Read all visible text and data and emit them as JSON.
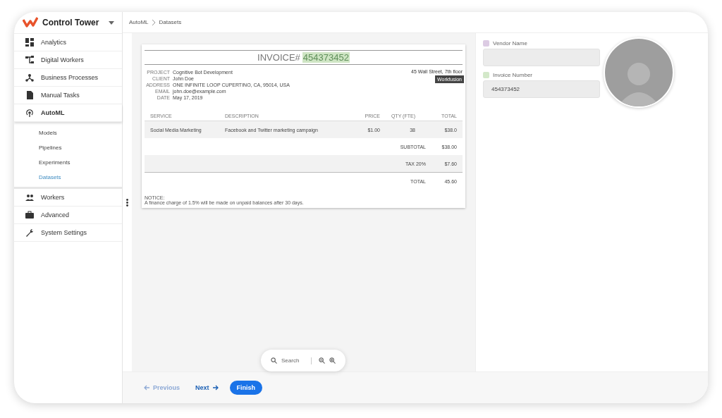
{
  "app": {
    "title": "Control Tower"
  },
  "sidebar": {
    "items": [
      {
        "label": "Analytics"
      },
      {
        "label": "Digital Workers"
      },
      {
        "label": "Business Processes"
      },
      {
        "label": "Manual Tasks"
      },
      {
        "label": "AutoML",
        "expanded": true,
        "children": [
          {
            "label": "Models",
            "selected": false
          },
          {
            "label": "Pipelines",
            "selected": false
          },
          {
            "label": "Experiments",
            "selected": false
          },
          {
            "label": "Datasets",
            "selected": true
          }
        ]
      },
      {
        "label": "Workers"
      },
      {
        "label": "Advanced"
      },
      {
        "label": "System Settings"
      }
    ]
  },
  "breadcrumb": [
    "AutoML",
    "Datasets"
  ],
  "invoice": {
    "title": "INVOICE#",
    "number": "454373452",
    "details": [
      {
        "label": "PROJECT",
        "value": "Cognitive Bot Development"
      },
      {
        "label": "CLIENT",
        "value": "John Doe"
      },
      {
        "label": "ADDRESS",
        "value": "ONE INFINITE LOOP CUPERTINO, CA, 95014, USA"
      },
      {
        "label": "EMAIL",
        "value": "john.doe@example.com"
      },
      {
        "label": "DATE",
        "value": "May 17, 2019"
      }
    ],
    "company": [
      "45 Wall Street, 7th floor"
    ],
    "tooltip": "Workfusion",
    "columns": [
      "SERVICE",
      "DESCRIPTION",
      "PRICE",
      "QTY (FTE)",
      "TOTAL"
    ],
    "rows": [
      [
        "Social Media Marketing",
        "Facebook and Twitter marketing campaign",
        "$1.00",
        "38",
        "$38.0"
      ]
    ],
    "summary": [
      {
        "label": "SUBTOTAL",
        "value": "$38.00",
        "kind": "plain"
      },
      {
        "label": "TAX 20%",
        "value": "$7.60",
        "kind": "plain"
      },
      {
        "label": "TOTAL",
        "value": "45.60",
        "kind": "total"
      }
    ],
    "notice_title": "NOTICE:",
    "notice": "A finance charge of 1.5% will be made on unpaid balances after 30 days."
  },
  "search": {
    "placeholder": "Search"
  },
  "fields": [
    {
      "label": "Vendor Name",
      "color": "#dccbe3"
    },
    {
      "label": "Invoice Number",
      "value": "454373452",
      "color": "#d3e8c9"
    }
  ],
  "nav": [
    {
      "label": "Previous",
      "disabled": true,
      "kind": "back"
    },
    {
      "label": "Next",
      "disabled": false,
      "kind": "forward"
    },
    {
      "label": "Finish",
      "disabled": false,
      "kind": "primary"
    }
  ]
}
